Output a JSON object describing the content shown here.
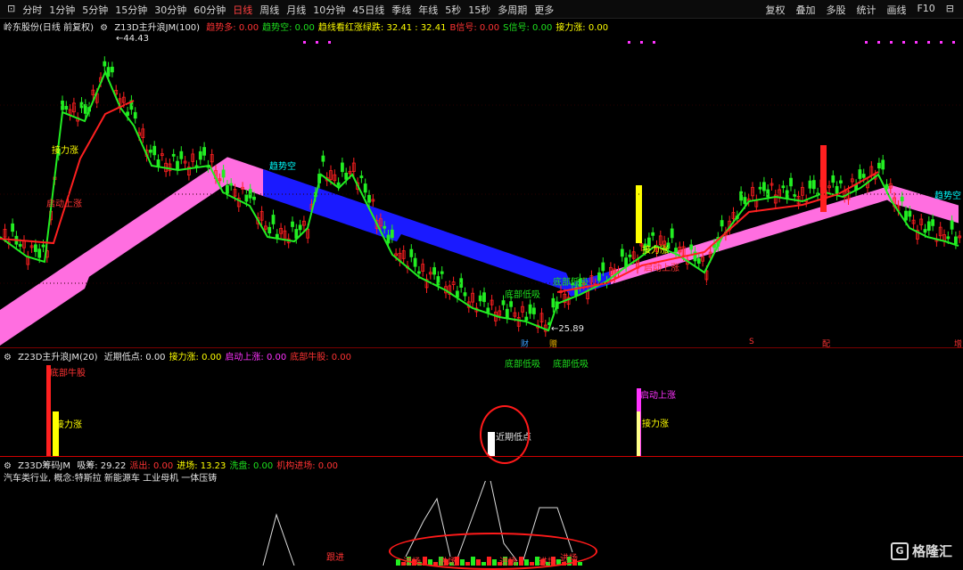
{
  "toolbar": {
    "left_items": [
      "⊡",
      "分时",
      "1分钟",
      "5分钟",
      "15分钟",
      "30分钟",
      "60分钟",
      "日线",
      "周线",
      "月线",
      "10分钟",
      "45日线",
      "季线",
      "年线",
      "5秒",
      "15秒",
      "多周期",
      "更多"
    ],
    "active_item": "日线",
    "right_items": [
      "复权",
      "叠加",
      "多股",
      "统计",
      "画线",
      "F10",
      "⊟"
    ]
  },
  "main_panel": {
    "stock_title": "岭东股份(日线 前复权)",
    "indicator_name": "Z13D主升浪JM(100)",
    "params": [
      {
        "label": "趋势多: 0.00",
        "color": "#ff3333"
      },
      {
        "label": "趋势空: 0.00",
        "color": "#1ee01e"
      },
      {
        "label": "趋线看红涨绿跌: 32.41 : 32.41",
        "color": "#ffff00"
      },
      {
        "label": "B信号: 0.00",
        "color": "#ff3333"
      },
      {
        "label": "S信号: 0.00",
        "color": "#1ee01e"
      },
      {
        "label": "接力涨: 0.00",
        "color": "#ffff00"
      }
    ],
    "high_price": "44.43",
    "low_price": "25.89",
    "annotations": [
      "接力涨",
      "启动上涨",
      "趋势空",
      "趋势空",
      "接力涨",
      "启动上涨"
    ],
    "mid_labels": [
      "底部低吸",
      "底部低吸"
    ],
    "date_marks": [
      {
        "label": "财",
        "color": "#3aa0ff"
      },
      {
        "label": "赠",
        "color": "#e8b000"
      },
      {
        "label": "S",
        "color": "#ff3333"
      },
      {
        "label": "配",
        "color": "#ff3333"
      },
      {
        "label": "增",
        "color": "#ff3333"
      }
    ]
  },
  "ind_panel": {
    "name": "Z23D主升浪JM(20)",
    "params": [
      {
        "label": "近期低点: 0.00",
        "color": "#e6e6e6"
      },
      {
        "label": "接力涨: 0.00",
        "color": "#ffff00"
      },
      {
        "label": "启动上涨: 0.00",
        "color": "#ff33ff"
      },
      {
        "label": "底部牛股: 0.00",
        "color": "#ff3333"
      }
    ],
    "bar_labels": [
      "底部牛股",
      "接力涨",
      "近期低点",
      "启动上涨",
      "接力涨"
    ]
  },
  "chip_panel": {
    "name": "Z33D筹码JM",
    "params": [
      {
        "label": "吸筹: 29.22",
        "color": "#e6e6e6"
      },
      {
        "label": "派出: 0.00",
        "color": "#ff3333"
      },
      {
        "label": "进场: 13.23",
        "color": "#ffff00"
      },
      {
        "label": "洗盘: 0.00",
        "color": "#1ee01e"
      },
      {
        "label": "机构进场: 0.00",
        "color": "#ff3333"
      }
    ],
    "sector": "汽车类行业, 概念:特斯拉 新能源车 工业母机 一体压铸",
    "signals": [
      "跟进",
      "进场",
      "进场",
      "进场",
      "进场",
      "进场"
    ]
  },
  "watermark": "格隆汇",
  "colors": {
    "up": "#ff2020",
    "down": "#22ee22",
    "band_up": "#ff6ee0",
    "band_down": "#1a1aff"
  }
}
